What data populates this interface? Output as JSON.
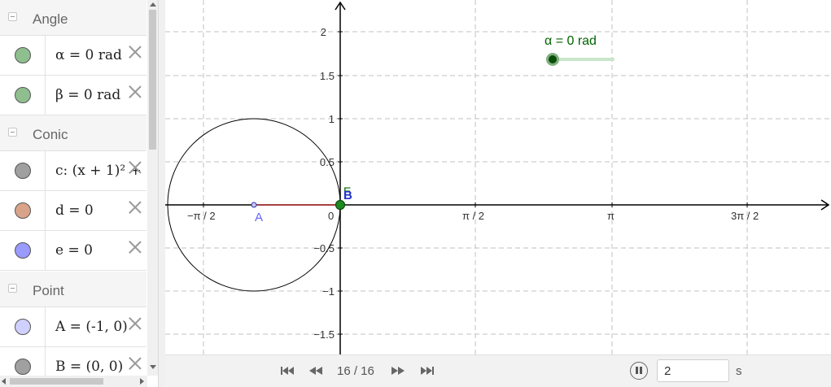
{
  "colors": {
    "accent_green": "#006400",
    "slider_track": "#c8e6c9",
    "axis": "#000000",
    "grid": "#c0c0c0",
    "segment_red": "#cc0000",
    "point_blue": "#6666ff"
  },
  "algebra": {
    "groups": [
      {
        "label": "Angle"
      },
      {
        "label": "Conic"
      },
      {
        "label": "Point"
      }
    ],
    "items": [
      {
        "formula": "α = 0 rad",
        "color": "#8fbf8f"
      },
      {
        "formula": "β = 0 rad",
        "color": "#8fbf8f"
      },
      {
        "formula": "c: (x + 1)² + ",
        "color": "#a0a0a0"
      },
      {
        "formula": "d = 0",
        "color": "#d9a38a"
      },
      {
        "formula": "e = 0",
        "color": "#9a9aff"
      },
      {
        "formula": "A = (-1, 0)",
        "color": "#d0d0ff"
      },
      {
        "formula": "B = (0, 0)",
        "color": "#a0a0a0"
      }
    ]
  },
  "graphics": {
    "x_ticks": [
      "−π / 2",
      "0",
      "π / 2",
      "π",
      "3π / 2"
    ],
    "y_ticks": [
      "2",
      "1.5",
      "1",
      "0.5",
      "−0.5",
      "−1",
      "−1.5"
    ],
    "point_labels": {
      "A": "A",
      "B": "B",
      "E": "E"
    },
    "slider_label": "α = 0 rad"
  },
  "animation": {
    "counter": "16 / 16",
    "speed_value": "2",
    "speed_unit": "s"
  }
}
